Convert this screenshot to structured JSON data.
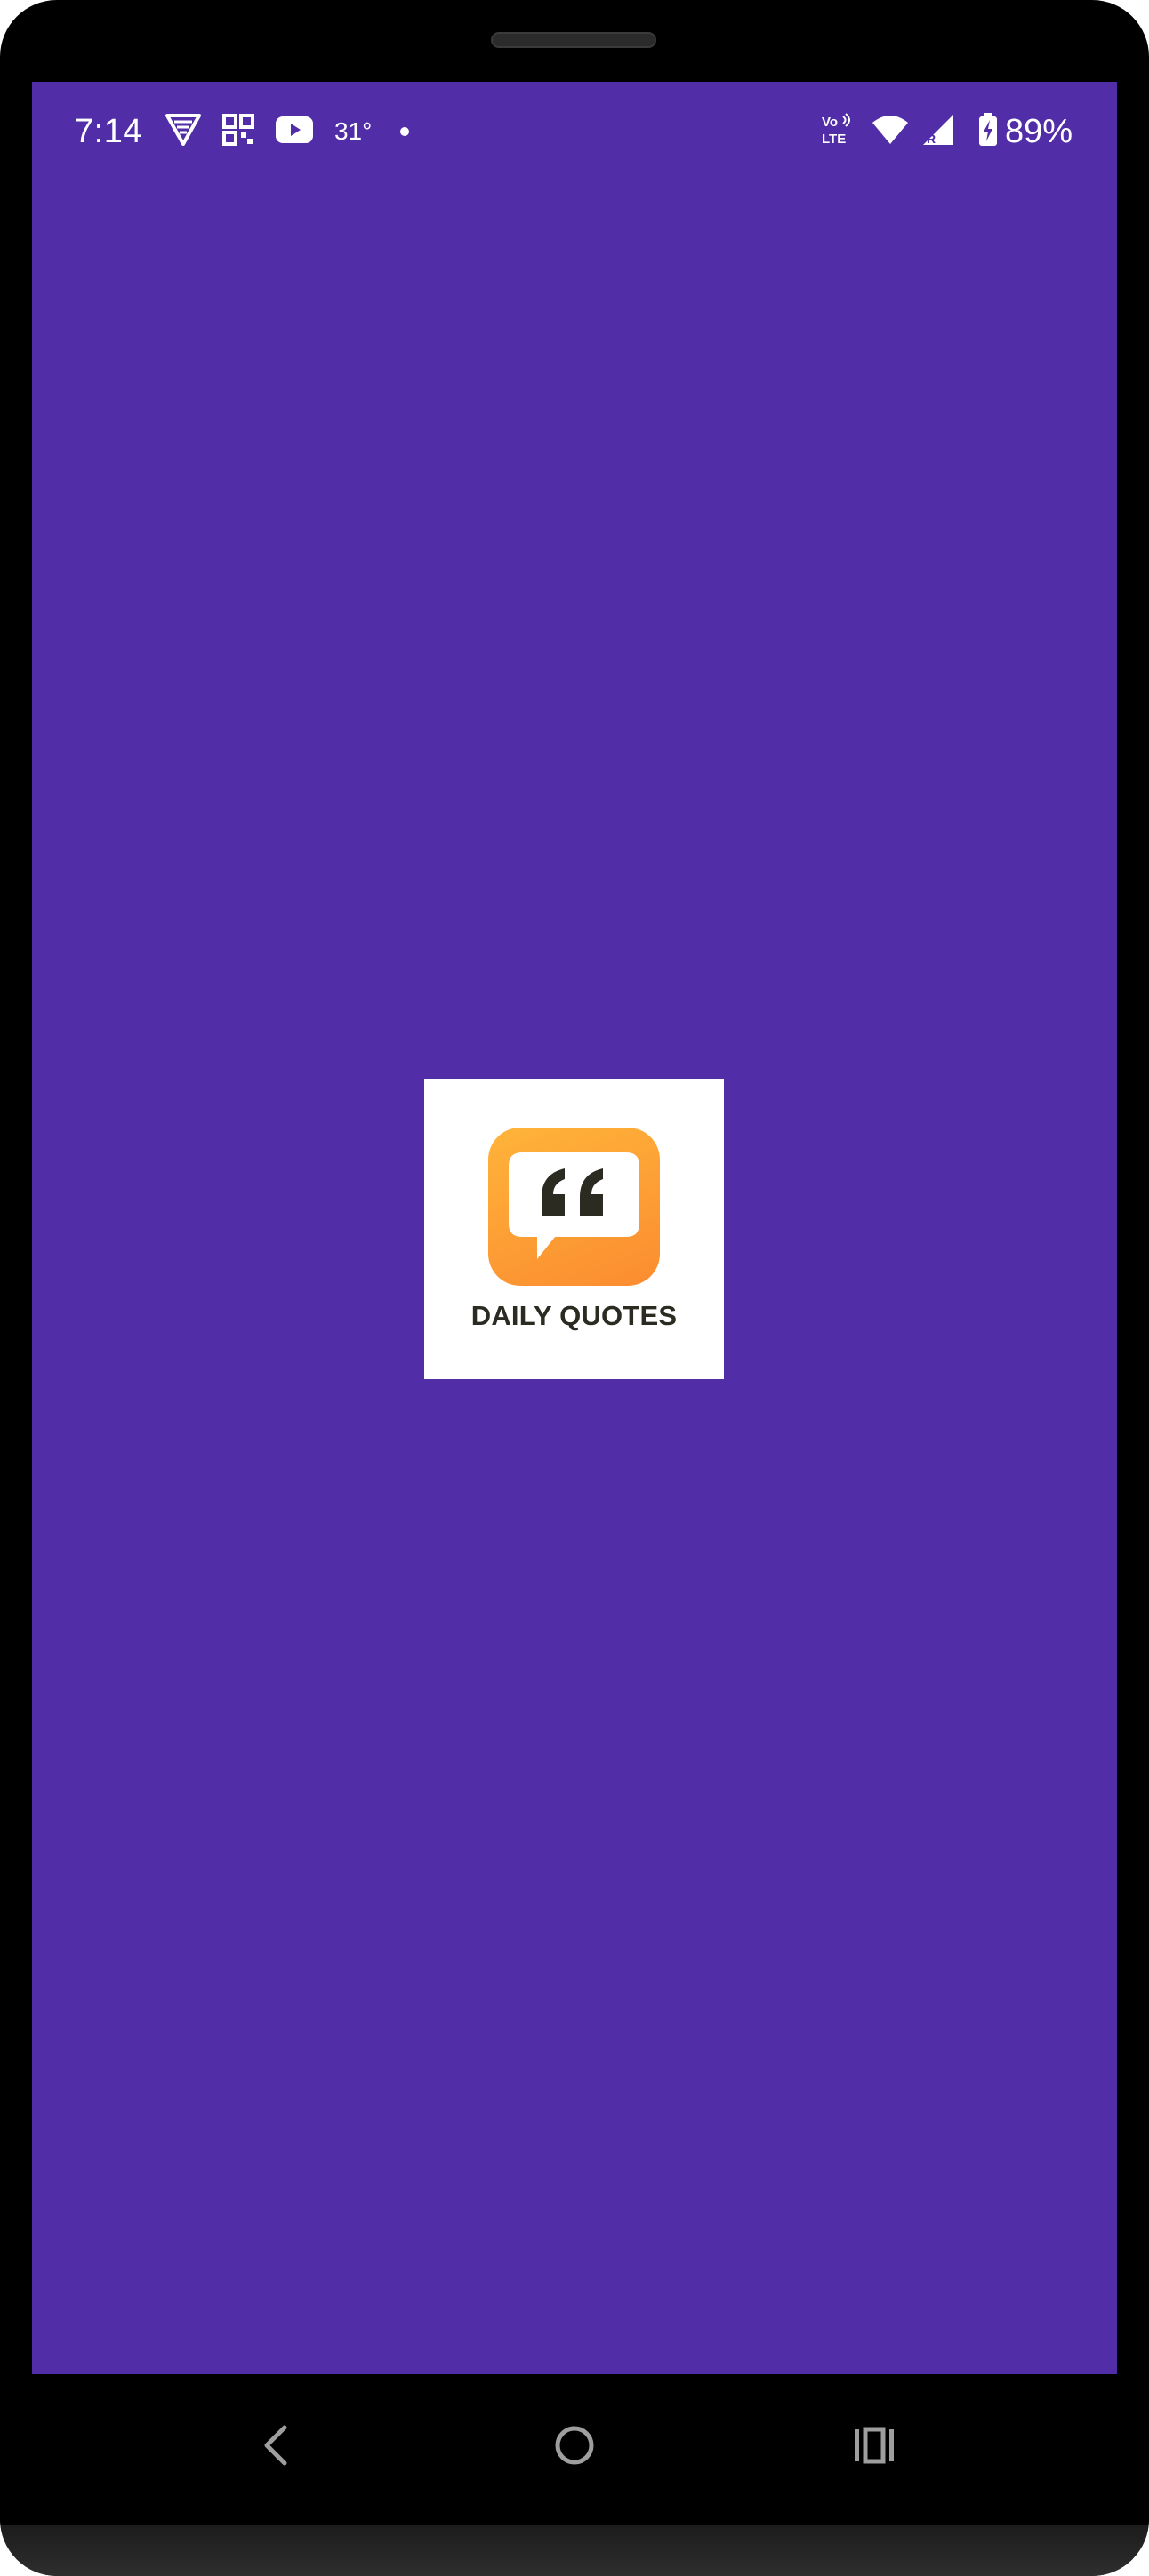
{
  "status_bar": {
    "time": "7:14",
    "temperature": "31°",
    "left_icons": [
      "vpn-shield-icon",
      "qr-scanner-icon",
      "youtube-icon",
      "notification-dot-icon"
    ],
    "right_icons": [
      "volte-icon",
      "wifi-icon",
      "signal-roaming-icon",
      "battery-charging-icon"
    ],
    "volte_label_top": "Vo",
    "volte_label_bottom": "LTE",
    "roaming_label": "R",
    "battery_percent": "89%"
  },
  "splash": {
    "app_name": "DAILY QUOTES",
    "logo_icon": "quote-bubble-icon",
    "colors": {
      "background": "#512da8",
      "tile_top": "#ffb43a",
      "tile_bottom": "#fb8c30",
      "glyph": "#2b2b22",
      "card": "#ffffff"
    }
  },
  "nav_bar": {
    "buttons": [
      "back-icon",
      "home-icon",
      "recents-icon"
    ]
  }
}
